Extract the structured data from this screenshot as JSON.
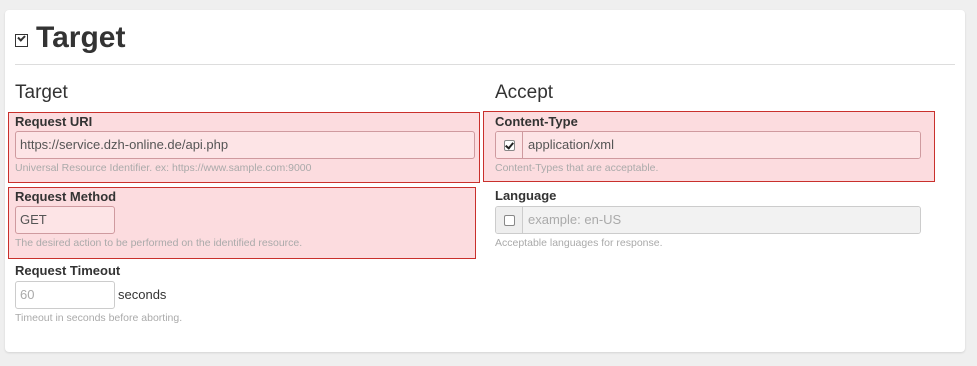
{
  "page": {
    "title": "Target"
  },
  "sections": {
    "target_heading": "Target",
    "accept_heading": "Accept"
  },
  "request_uri": {
    "label": "Request URI",
    "value": "https://service.dzh-online.de/api.php",
    "help": "Universal Resource Identifier. ex: https://www.sample.com:9000"
  },
  "request_method": {
    "label": "Request Method",
    "value": "GET",
    "help": "The desired action to be performed on the identified resource."
  },
  "request_timeout": {
    "label": "Request Timeout",
    "value": "60",
    "unit": "seconds",
    "help": "Timeout in seconds before aborting."
  },
  "content_type": {
    "label": "Content-Type",
    "checked": true,
    "value": "application/xml",
    "help": "Content-Types that are acceptable."
  },
  "language": {
    "label": "Language",
    "checked": false,
    "placeholder": "example: en-US",
    "help": "Acceptable languages for response."
  },
  "colors": {
    "error_background": "#fcdcdf",
    "error_border": "#c9302c"
  }
}
